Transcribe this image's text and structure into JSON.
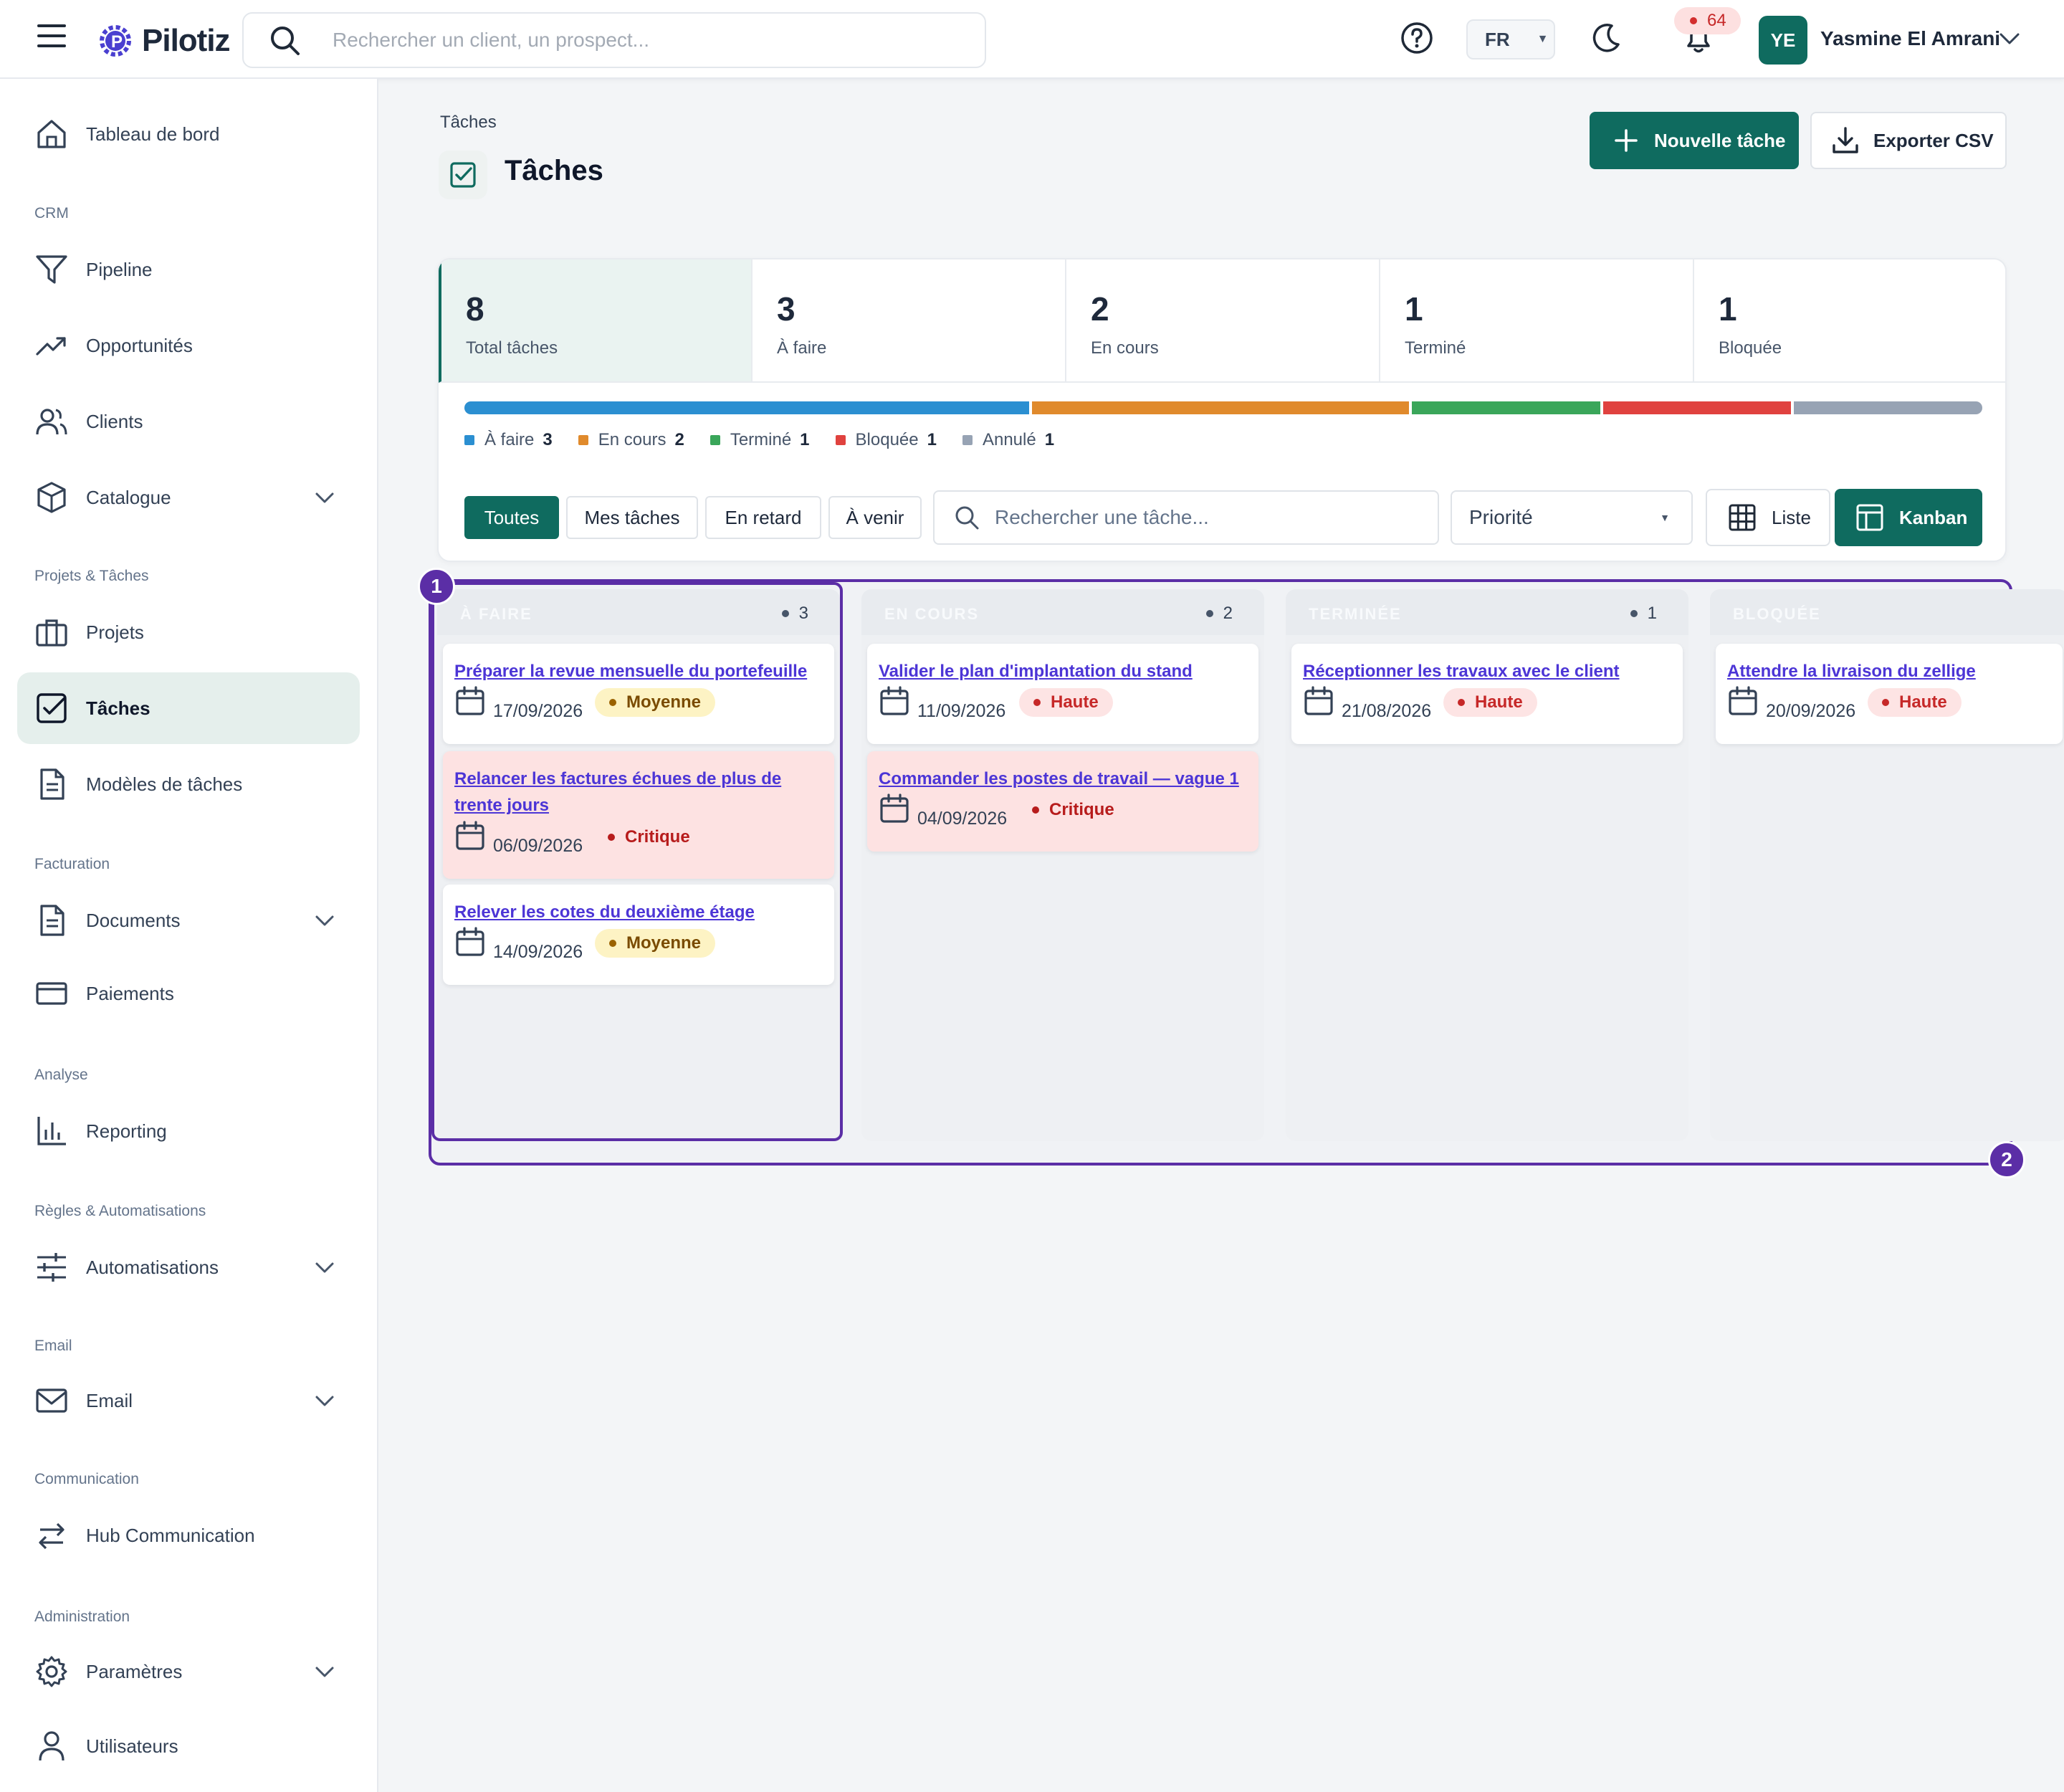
{
  "app": {
    "logo_text": "Pilotiz",
    "search_placeholder": "Rechercher un client, un prospect...",
    "language": "FR",
    "notifications_count": "64",
    "user_initials": "YE",
    "user_name": "Yasmine El Amrani"
  },
  "sidebar": {
    "sections": {
      "crm": "CRM",
      "projects": "Projets & Tâches",
      "billing": "Facturation",
      "analysis": "Analyse",
      "rules": "Règles & Automatisations",
      "email": "Email",
      "communication": "Communication",
      "admin": "Administration"
    },
    "items": {
      "dashboard": "Tableau de bord",
      "pipeline": "Pipeline",
      "opportunities": "Opportunités",
      "clients": "Clients",
      "catalog": "Catalogue",
      "projects": "Projets",
      "tasks": "Tâches",
      "task_templates": "Modèles de tâches",
      "documents": "Documents",
      "payments": "Paiements",
      "reporting": "Reporting",
      "automations": "Automatisations",
      "email": "Email",
      "hub": "Hub Communication",
      "settings": "Paramètres",
      "users": "Utilisateurs"
    }
  },
  "page": {
    "breadcrumb": "Tâches",
    "title": "Tâches",
    "new_task_label": "Nouvelle tâche",
    "export_label": "Exporter CSV"
  },
  "stats": [
    {
      "value": "8",
      "label": "Total tâches"
    },
    {
      "value": "3",
      "label": "À faire"
    },
    {
      "value": "2",
      "label": "En cours"
    },
    {
      "value": "1",
      "label": "Terminé"
    },
    {
      "value": "1",
      "label": "Bloquée"
    }
  ],
  "status_distribution": [
    {
      "label": "À faire",
      "count": "3",
      "color": "#2b8fd1",
      "weight": 3
    },
    {
      "label": "En cours",
      "count": "2",
      "color": "#e08a2c",
      "weight": 2
    },
    {
      "label": "Terminé",
      "count": "1",
      "color": "#3aa65a",
      "weight": 1
    },
    {
      "label": "Bloquée",
      "count": "1",
      "color": "#e0423f",
      "weight": 1
    },
    {
      "label": "Annulé",
      "count": "1",
      "color": "#97a3b4",
      "weight": 1
    }
  ],
  "filters": {
    "all": "Toutes",
    "mine": "Mes tâches",
    "late": "En retard",
    "upcoming": "À venir",
    "search_placeholder": "Rechercher une tâche...",
    "priority": "Priorité",
    "view_list": "Liste",
    "view_kanban": "Kanban"
  },
  "markers": {
    "first": "1",
    "second": "2"
  },
  "kanban": {
    "columns": [
      {
        "title": "À FAIRE",
        "count": "3",
        "cards": [
          {
            "title": "Préparer la revue mensuelle du portefeuille",
            "date": "17/09/2026",
            "priority": "Moyenne"
          },
          {
            "title": "Relancer les factures échues de plus de trente jours",
            "date": "06/09/2026",
            "priority": "Critique"
          },
          {
            "title": "Relever les cotes du deuxième étage",
            "date": "14/09/2026",
            "priority": "Moyenne"
          }
        ]
      },
      {
        "title": "EN COURS",
        "count": "2",
        "cards": [
          {
            "title": "Valider le plan d'implantation du stand",
            "date": "11/09/2026",
            "priority": "Haute"
          },
          {
            "title": "Commander les postes de travail — vague 1",
            "date": "04/09/2026",
            "priority": "Critique"
          }
        ]
      },
      {
        "title": "TERMINÉE",
        "count": "1",
        "cards": [
          {
            "title": "Réceptionner les travaux avec le client",
            "date": "21/08/2026",
            "priority": "Haute"
          }
        ]
      },
      {
        "title": "BLOQUÉE",
        "count": "",
        "cards": [
          {
            "title": "Attendre la livraison du zellige",
            "date": "20/09/2026",
            "priority": "Haute"
          }
        ]
      }
    ]
  },
  "colors": {
    "accent": "#0f6b5f",
    "highlight": "#5b2ea6",
    "link": "#4c35d6"
  }
}
